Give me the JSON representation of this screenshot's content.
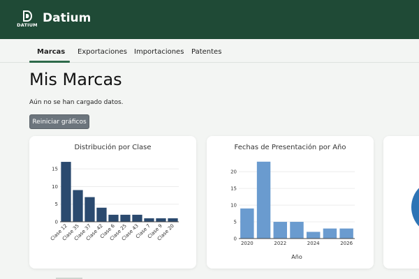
{
  "app": {
    "brand": "Datium",
    "logo_text": "DATIUM",
    "logo_icon": "datium-d-logo-icon"
  },
  "nav": {
    "tabs": [
      {
        "label": "Marcas",
        "active": true
      },
      {
        "label": "Exportaciones",
        "active": false
      },
      {
        "label": "Importaciones",
        "active": false
      },
      {
        "label": "Patentes",
        "active": false
      }
    ]
  },
  "main": {
    "title": "Mis Marcas",
    "empty_message": "Aún no se han cargado datos.",
    "reset_button": "Reiniciar gráficos"
  },
  "colors": {
    "header_bg": "#1f4a36",
    "accent": "#2d6a4a",
    "bar_dark": "#2b4a6f",
    "bar_light": "#6a9bcf",
    "button_bg": "#6c757d"
  },
  "chart_data": [
    {
      "type": "bar",
      "title": "Distribución por Clase",
      "categories": [
        "Clase 12",
        "Clase 35",
        "Clase 37",
        "Clase 42",
        "Clase 6",
        "Clase 25",
        "Clase 43",
        "Clase 7",
        "Clase 9",
        "Clase 20"
      ],
      "values": [
        17,
        9,
        7,
        4,
        2,
        2,
        2,
        1,
        1,
        1
      ],
      "yticks": [
        0,
        5,
        10,
        15
      ],
      "ylim": [
        0,
        18
      ],
      "xlabel": "",
      "ylabel": "",
      "grid": true
    },
    {
      "type": "bar",
      "title": "Fechas de Presentación por Año",
      "x": [
        2020,
        2021,
        2022,
        2023,
        2024,
        2025,
        2026
      ],
      "values": [
        9,
        23,
        5,
        5,
        2,
        3,
        3
      ],
      "xticks": [
        2020,
        2022,
        2024,
        2026
      ],
      "yticks": [
        0,
        5,
        10,
        15,
        20
      ],
      "ylim": [
        0,
        24
      ],
      "xlabel": "Año",
      "ylabel": "",
      "grid": true
    }
  ]
}
